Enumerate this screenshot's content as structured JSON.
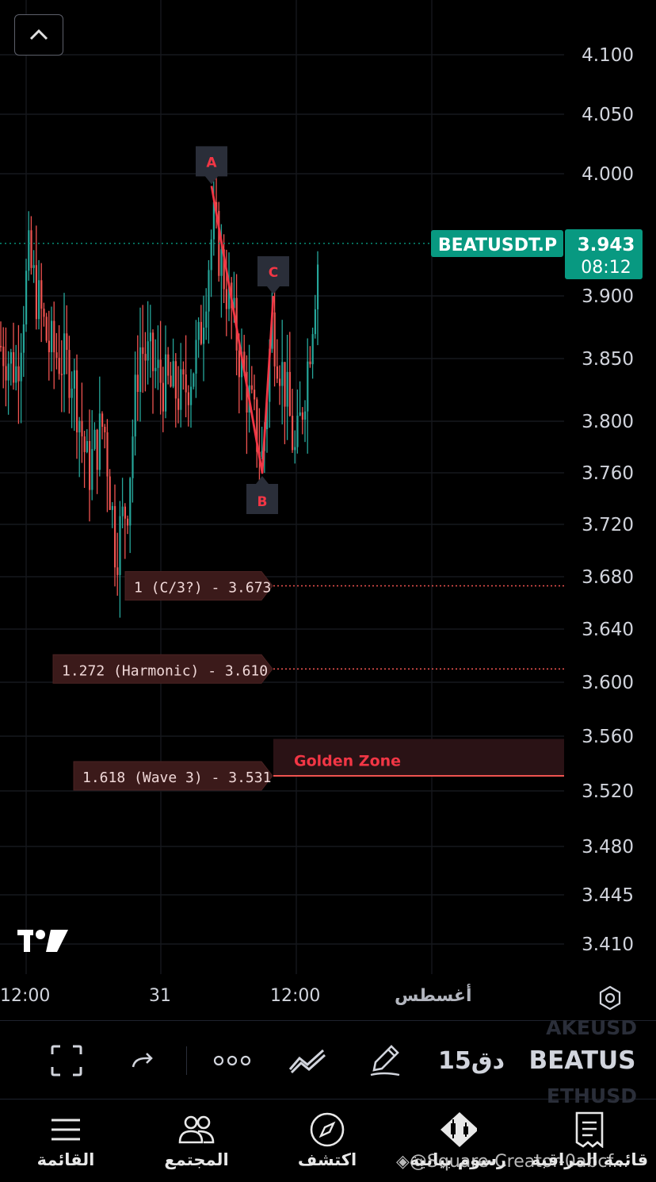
{
  "chart_data": {
    "type": "candlestick",
    "symbol_label": "BEATUSDT.P",
    "last_price": "3.943",
    "countdown": "08:12",
    "y_ticks": [
      "4.100",
      "4.050",
      "4.000",
      "3.900",
      "3.850",
      "3.800",
      "3.760",
      "3.720",
      "3.680",
      "3.640",
      "3.600",
      "3.560",
      "3.520",
      "3.480",
      "3.445",
      "3.410"
    ],
    "x_ticks": [
      "12:00",
      "31",
      "12:00",
      "أغسطس"
    ],
    "wave_points": [
      {
        "label": "A",
        "price": 3.99
      },
      {
        "label": "B",
        "price": 3.76
      },
      {
        "label": "C",
        "price": 3.9
      }
    ],
    "fib_levels": [
      {
        "label": "1 (C/3?) - 3.673",
        "price": 3.673
      },
      {
        "label": "1.272 (Harmonic) - 3.610",
        "price": 3.61
      },
      {
        "label": "1.618 (Wave 3) - 3.531",
        "price": 3.531
      }
    ],
    "zone": {
      "label": "Golden Zone",
      "price_top": 3.558,
      "price_bottom": 3.531
    },
    "colors": {
      "up": "#26a69a",
      "down": "#ef5350",
      "accent": "#089981",
      "zone_text": "#f23645"
    }
  },
  "toolbar": {
    "symbol": "BEATUS",
    "interval": "15دق",
    "ghost_above": "AKEUSD",
    "ghost_below": "ETHUSD"
  },
  "nav": {
    "items": [
      {
        "label": "القائمة",
        "icon": "menu-icon"
      },
      {
        "label": "المجتمع",
        "icon": "community-icon"
      },
      {
        "label": "اكتشف",
        "icon": "compass-icon"
      },
      {
        "label": "رسوم بيانية",
        "icon": "charts-icon"
      },
      {
        "label": "قائمة المراقبة",
        "icon": "watchlist-icon"
      }
    ]
  },
  "watermark": "◈@Square-Creator-0abcf..."
}
